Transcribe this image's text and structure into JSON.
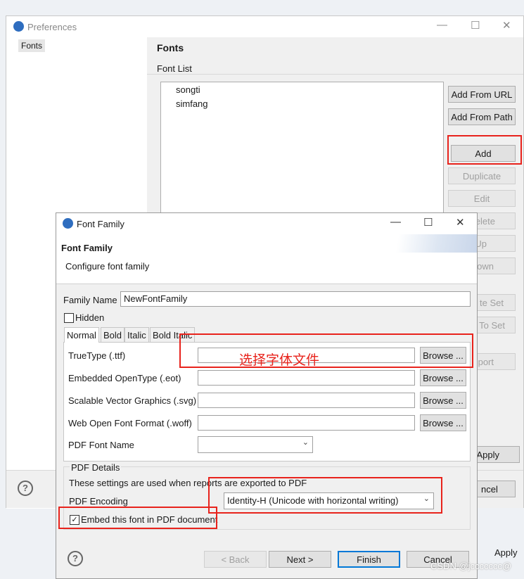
{
  "preferences": {
    "title": "Preferences",
    "tree_item": "Fonts",
    "section_title": "Fonts",
    "font_list_label": "Font List",
    "fonts": [
      "songti",
      "simfang"
    ],
    "buttons": {
      "add_from_url": "Add From URL",
      "add_from_path": "Add From Path",
      "add": "Add",
      "duplicate": "Duplicate",
      "edit": "Edit",
      "delete_partial": "elete",
      "up_partial": "Up",
      "down_partial": "own",
      "create_set_partial": "te Set",
      "add_to_set_partial": "To Set",
      "export_partial": "port",
      "apply": "Apply",
      "cancel_partial": "ncel",
      "apply_bottom": "Apply"
    }
  },
  "dialog": {
    "title": "Font Family",
    "header_title": "Font Family",
    "header_subtitle": "Configure font family",
    "family_name_label": "Family Name",
    "family_name_value": "NewFontFamily",
    "hidden_label": "Hidden",
    "tabs": [
      "Normal",
      "Bold",
      "Italic",
      "Bold Italic"
    ],
    "rows": [
      {
        "label": "TrueType (.ttf)",
        "browse": "Browse ..."
      },
      {
        "label": "Embedded OpenType (.eot)",
        "browse": "Browse ..."
      },
      {
        "label": "Scalable Vector Graphics (.svg)",
        "browse": "Browse ..."
      },
      {
        "label": "Web Open Font Format (.woff)",
        "browse": "Browse ..."
      }
    ],
    "pdf_font_name_label": "PDF Font Name",
    "pdf_details_label": "PDF Details",
    "pdf_details_text": "These settings are used when reports are exported to PDF",
    "pdf_encoding_label": "PDF Encoding",
    "pdf_encoding_value": "Identity-H (Unicode with horizontal writing)",
    "embed_label": "Embed this font in PDF document",
    "annotation": "选择字体文件",
    "footer": {
      "back": "< Back",
      "next": "Next >",
      "finish": "Finish",
      "cancel": "Cancel"
    }
  },
  "watermark": "CSDN @jccccccc@",
  "colors": {
    "annotation_red": "#e8231c",
    "focus_blue": "#0078d7"
  }
}
